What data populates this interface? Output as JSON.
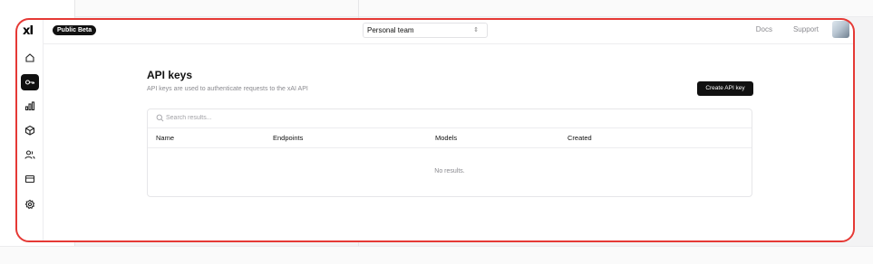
{
  "header": {
    "badge": "Public Beta",
    "team_select": "Personal team",
    "docs": "Docs",
    "support": "Support"
  },
  "sidebar": {
    "logo": "xI",
    "items": [
      {
        "icon": "home-icon"
      },
      {
        "icon": "key-icon",
        "active": true
      },
      {
        "icon": "bar-chart-icon"
      },
      {
        "icon": "cube-icon"
      },
      {
        "icon": "users-icon"
      },
      {
        "icon": "card-icon"
      },
      {
        "icon": "gear-icon"
      }
    ]
  },
  "main": {
    "title": "API keys",
    "subtitle": "API keys are used to authenticate requests to the xAI API",
    "create_button": "Create API key",
    "search_placeholder": "Search results...",
    "columns": [
      "Name",
      "Endpoints",
      "Models",
      "Created"
    ],
    "empty_text": "No results."
  },
  "colors": {
    "highlight": "#e53935",
    "primary": "#111111"
  }
}
